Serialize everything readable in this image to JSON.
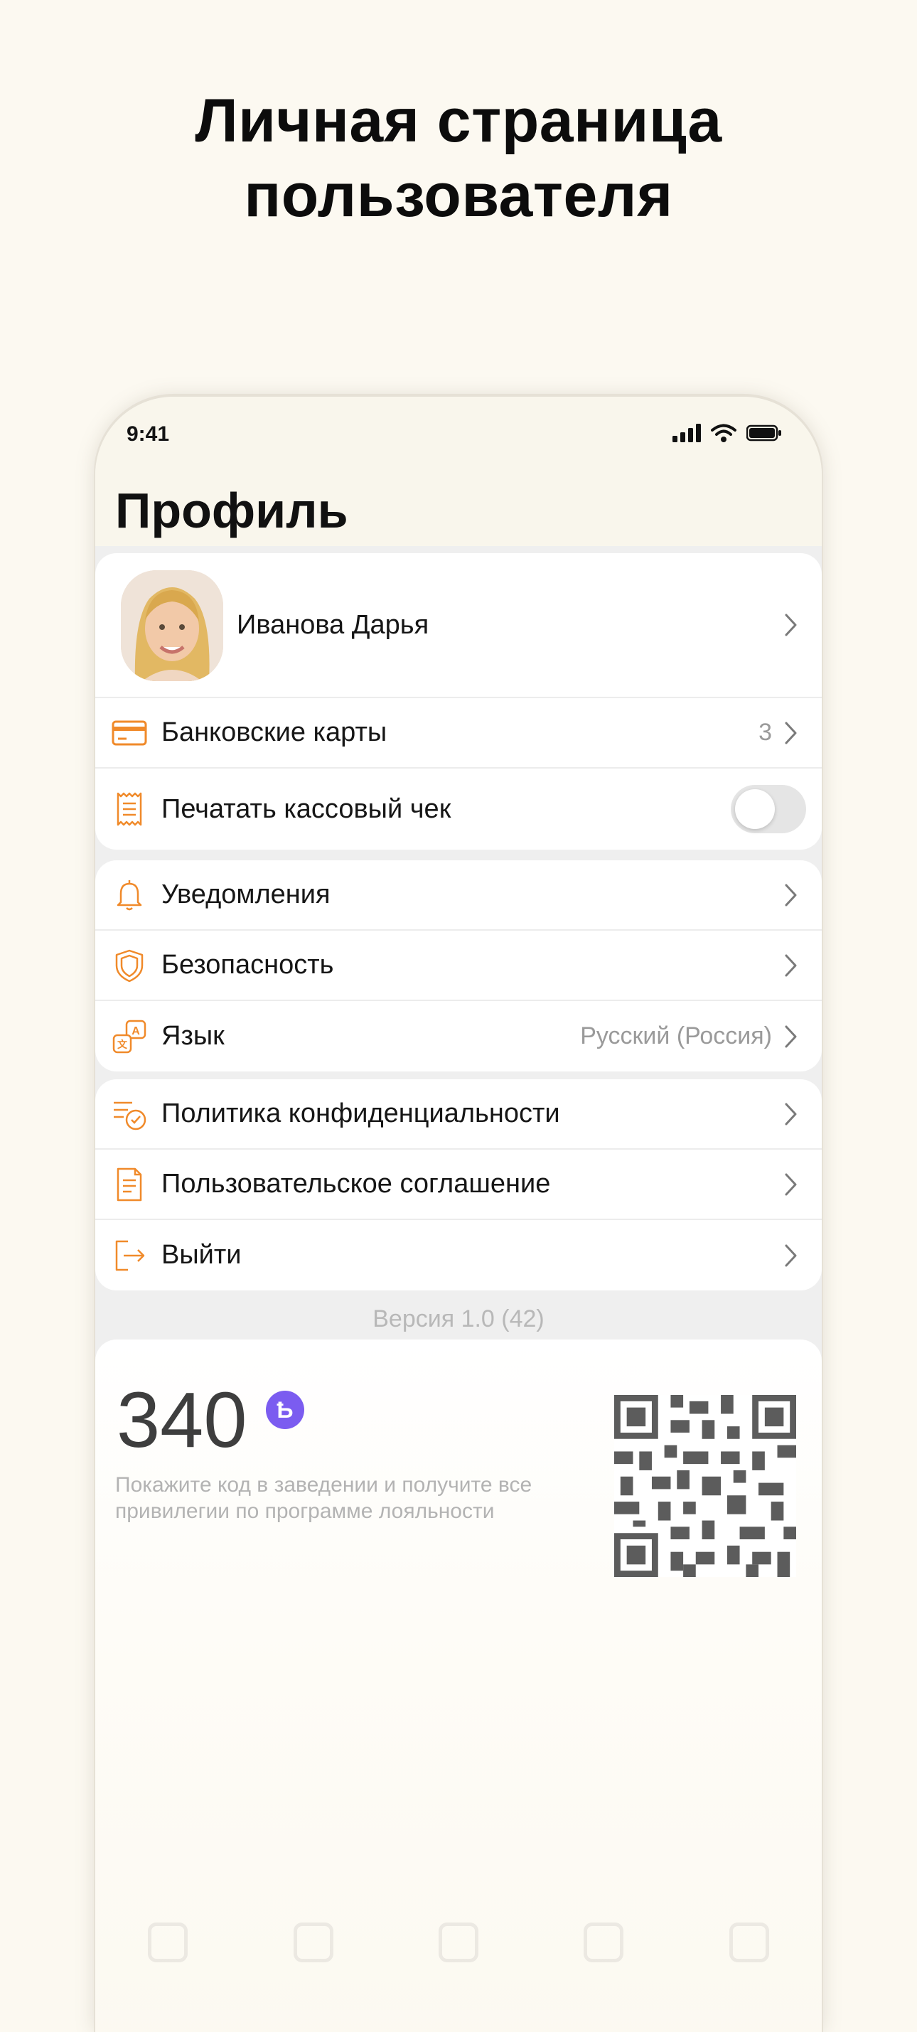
{
  "headline": {
    "line1": "Личная страница",
    "line2": "пользователя"
  },
  "status_bar": {
    "time": "9:41",
    "signal_icon": "signal-icon",
    "wifi_icon": "wifi-icon",
    "battery_icon": "battery-icon"
  },
  "page_title": "Профиль",
  "profile": {
    "name": "Иванова Дарья"
  },
  "group1": {
    "bank_cards": {
      "label": "Банковские карты",
      "value": "3",
      "icon": "credit-card-icon"
    },
    "print_receipt": {
      "label": "Печатать кассовый чек",
      "icon": "receipt-icon",
      "toggle_on": false
    }
  },
  "group2": {
    "notifications": {
      "label": "Уведомления",
      "icon": "bell-icon"
    },
    "security": {
      "label": "Безопасность",
      "icon": "shield-icon"
    },
    "language": {
      "label": "Язык",
      "value": "Русский (Россия)",
      "icon": "translate-icon"
    }
  },
  "group3": {
    "privacy": {
      "label": "Политика конфиденциальности",
      "icon": "policy-check-icon"
    },
    "agreement": {
      "label": "Пользовательское соглашение",
      "icon": "document-icon"
    },
    "logout": {
      "label": "Выйти",
      "icon": "logout-icon"
    }
  },
  "version": "Версия 1.0 (42)",
  "loyalty": {
    "points": "340",
    "currency_symbol": "Ҍ",
    "description": "Покажите код в заведении и получите все привилегии по программе лояльности"
  },
  "colors": {
    "accent": "#f08a2a",
    "coin": "#7b5cf0",
    "background": "#fcf9f1"
  }
}
